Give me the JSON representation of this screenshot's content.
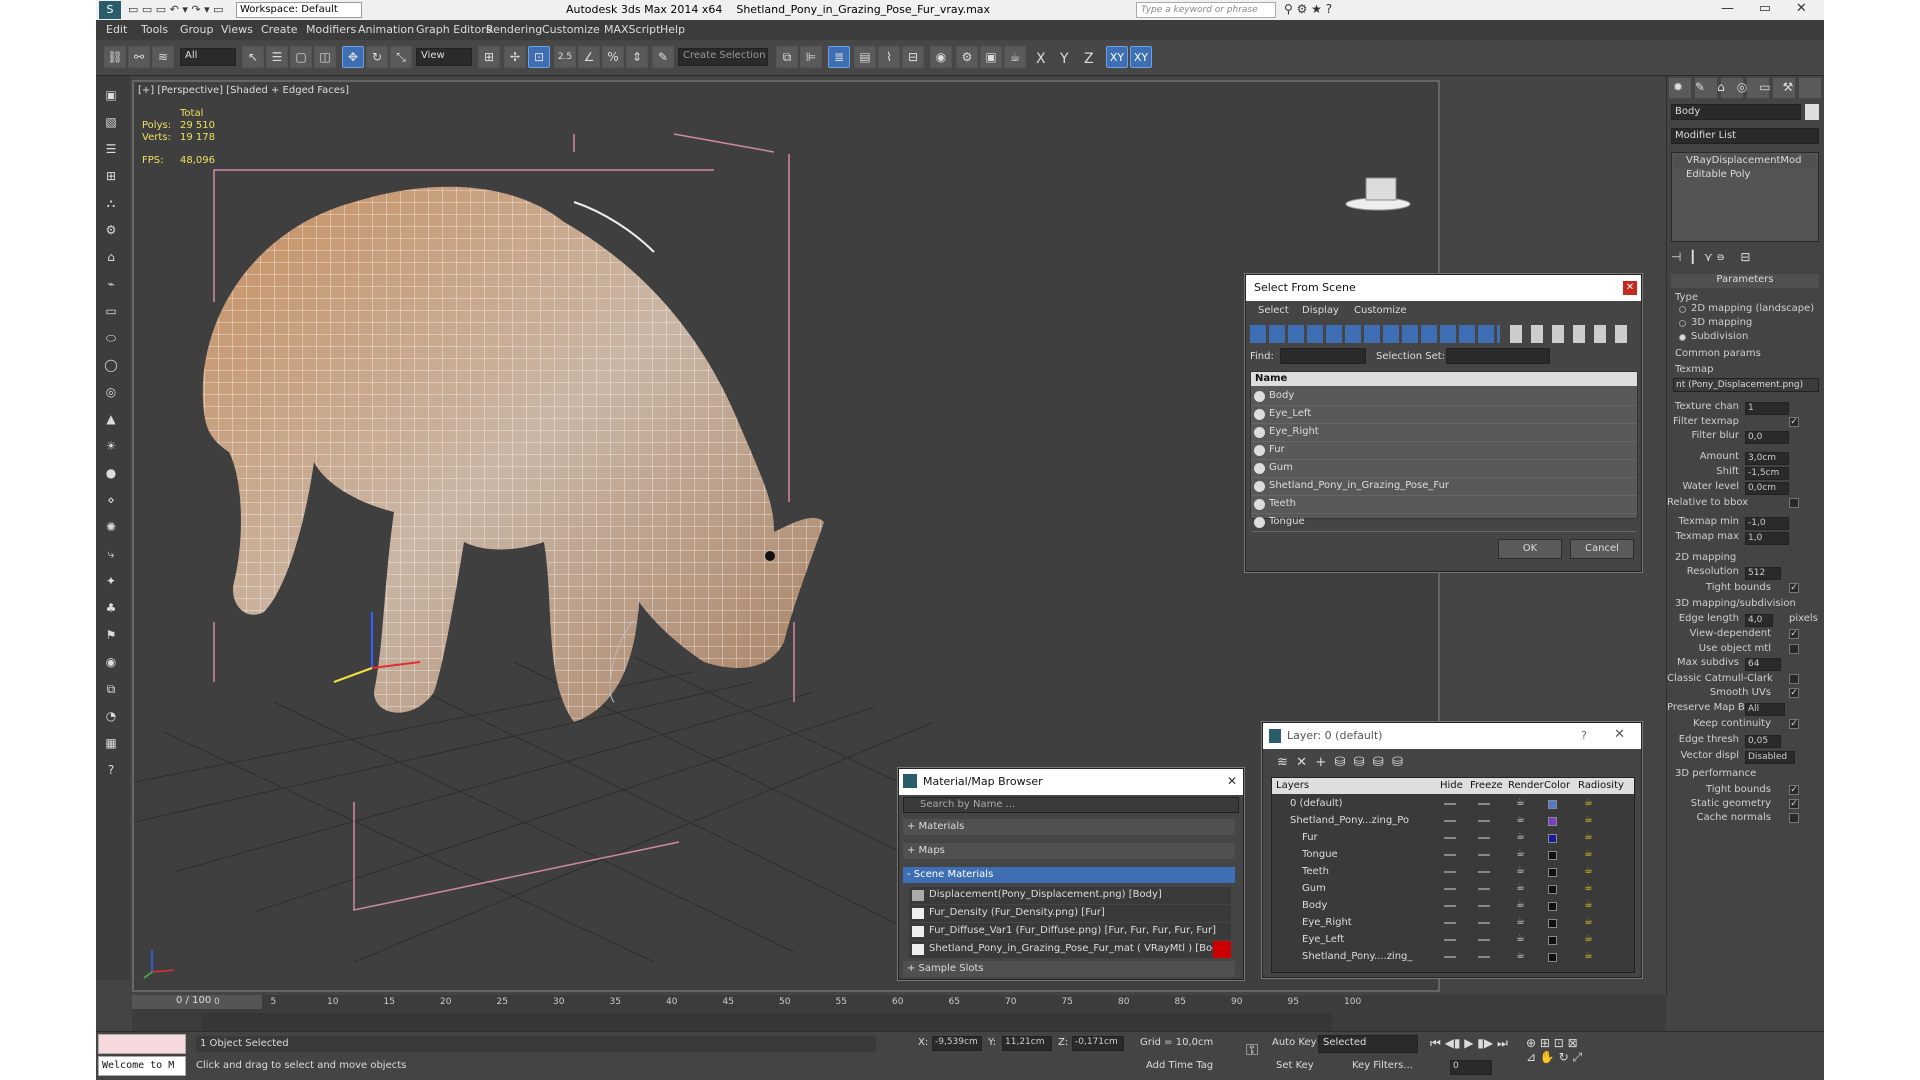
{
  "title": {
    "app": "Autodesk 3ds Max  2014 x64",
    "file": "Shetland_Pony_in_Grazing_Pose_Fur_vray.max",
    "workspace": "Workspace: Default",
    "search_placeholder": "Type a keyword or phrase"
  },
  "menu": [
    "Edit",
    "Tools",
    "Group",
    "Views",
    "Create",
    "Modifiers",
    "Animation",
    "Graph Editors",
    "Rendering",
    "Customize",
    "MAXScript",
    "Help"
  ],
  "toolbar": {
    "filter": "All",
    "refcoord": "View",
    "snap_angle": "2.5",
    "selection_set": "Create Selection Se",
    "axes": [
      "X",
      "Y",
      "Z",
      "XY",
      "XY"
    ]
  },
  "viewport": {
    "label": "[+] [Perspective] [Shaded + Edged Faces]",
    "stats": {
      "total": "Total",
      "polys_label": "Polys:",
      "polys": "29 510",
      "verts_label": "Verts:",
      "verts": "19 178",
      "fps_label": "FPS:",
      "fps": "48,096"
    }
  },
  "select_from_scene": {
    "title": "Select From Scene",
    "menus": [
      "Select",
      "Display",
      "Customize"
    ],
    "find_label": "Find:",
    "selset_label": "Selection Set:",
    "col_name": "Name",
    "items": [
      "Body",
      "Eye_Left",
      "Eye_Right",
      "Fur",
      "Gum",
      "Shetland_Pony_in_Grazing_Pose_Fur",
      "Teeth",
      "Tongue"
    ],
    "ok": "OK",
    "cancel": "Cancel"
  },
  "material_browser": {
    "title": "Material/Map Browser",
    "search_placeholder": "Search by Name ...",
    "groups": [
      "+ Materials",
      "+ Maps",
      "- Scene Materials"
    ],
    "items": [
      "Displacement(Pony_Displacement.png) [Body]",
      "Fur_Density (Fur_Density.png)  [Fur]",
      "Fur_Diffuse_Var1 (Fur_Diffuse.png)  [Fur, Fur, Fur, Fur, Fur]",
      "Shetland_Pony_in_Grazing_Pose_Fur_mat  ( VRayMtl )  [Body,..."
    ],
    "sample": "+ Sample Slots"
  },
  "layer_panel": {
    "title": "Layer: 0 (default)",
    "help": "?",
    "headers": [
      "Layers",
      "Hide",
      "Freeze",
      "Render",
      "Color",
      "Radiosity"
    ],
    "rows": [
      {
        "name": "0 (default)",
        "color": "#5577cc"
      },
      {
        "name": "Shetland_Pony...zing_Po",
        "color": "#7a3cc0"
      },
      {
        "name": "Fur",
        "color": "#1a1a9a"
      },
      {
        "name": "Tongue",
        "color": "#111"
      },
      {
        "name": "Teeth",
        "color": "#111"
      },
      {
        "name": "Gum",
        "color": "#111"
      },
      {
        "name": "Body",
        "color": "#111"
      },
      {
        "name": "Eye_Right",
        "color": "#111"
      },
      {
        "name": "Eye_Left",
        "color": "#111"
      },
      {
        "name": "Shetland_Pony....zing_",
        "color": "#111"
      }
    ]
  },
  "command_panel": {
    "object_name": "Body",
    "modifier_list": "Modifier List",
    "stack": [
      "VRayDisplacementMod",
      "Editable Poly"
    ],
    "rollout": "Parameters",
    "type_label": "Type",
    "type_opts": [
      "2D mapping (landscape)",
      "3D mapping",
      "Subdivision"
    ],
    "common": "Common params",
    "texmap": "Texmap",
    "texmap_val": "nt (Pony_Displacement.png)",
    "fields": [
      {
        "l": "Texture chan",
        "v": "1"
      },
      {
        "l": "Filter texmap",
        "c": "✓"
      },
      {
        "l": "Filter blur",
        "v": "0,0"
      },
      {
        "l": "Amount",
        "v": "3,0cm"
      },
      {
        "l": "Shift",
        "v": "-1,5cm"
      },
      {
        "l": "Water level",
        "v": "0,0cm"
      },
      {
        "l": "Relative to bbox",
        "c": ""
      },
      {
        "l": "Texmap min",
        "v": "-1,0"
      },
      {
        "l": "Texmap max",
        "v": "1,0"
      }
    ],
    "map2d": "2D mapping",
    "res_label": "Resolution",
    "res": "512",
    "tight": "Tight bounds",
    "map3d": "3D mapping/subdivision",
    "edge_label": "Edge length",
    "edge": "4,0",
    "pixels": "pixels",
    "view_dep": "View-dependent",
    "use_obj": "Use object mtl",
    "max_sub_label": "Max subdivs",
    "max_sub": "64",
    "catmull": "Classic Catmull-Clark",
    "smooth": "Smooth UVs",
    "pmb_label": "Preserve Map Bnd",
    "pmb": "All",
    "keep": "Keep continuity",
    "edge_thr_label": "Edge thresh",
    "edge_thr": "0,05",
    "vec_label": "Vector displ",
    "vec": "Disabled",
    "perf": "3D performance",
    "perf_items": [
      "Tight bounds",
      "Static geometry",
      "Cache normals"
    ]
  },
  "timeline": {
    "frame": "0 / 100",
    "ticks": [
      "0",
      "5",
      "10",
      "15",
      "20",
      "25",
      "30",
      "35",
      "40",
      "45",
      "50",
      "55",
      "60",
      "65",
      "70",
      "75",
      "80",
      "85",
      "90",
      "95",
      "100"
    ]
  },
  "status": {
    "maxscript": "Welcome to M",
    "selected": "1 Object Selected",
    "hint": "Click and drag to select and move objects",
    "x_label": "X:",
    "x": "-9,539cm",
    "y_label": "Y:",
    "y": "11,21cm",
    "z_label": "Z:",
    "z": "-0,171cm",
    "grid": "Grid = 10,0cm",
    "autokey": "Auto Key",
    "setkey": "Set Key",
    "selected_dd": "Selected",
    "keyfilters": "Key Filters...",
    "addtime": "Add Time Tag",
    "frame": "0"
  }
}
